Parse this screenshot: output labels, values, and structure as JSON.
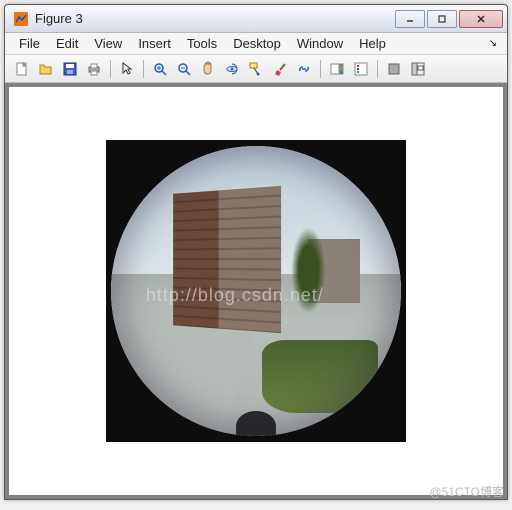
{
  "window": {
    "title": "Figure 3"
  },
  "menu": {
    "items": [
      "File",
      "Edit",
      "View",
      "Insert",
      "Tools",
      "Desktop",
      "Window",
      "Help"
    ]
  },
  "toolbar": {
    "tools": [
      "new",
      "open",
      "save",
      "print",
      "pointer",
      "zoom-in",
      "zoom-out",
      "pan",
      "rotate3d",
      "datacursor",
      "brush",
      "link",
      "colorbar",
      "legend",
      "hide",
      "dock"
    ]
  },
  "watermark": {
    "center": "http://blog.csdn.net/",
    "corner": "@51CTO博客"
  }
}
